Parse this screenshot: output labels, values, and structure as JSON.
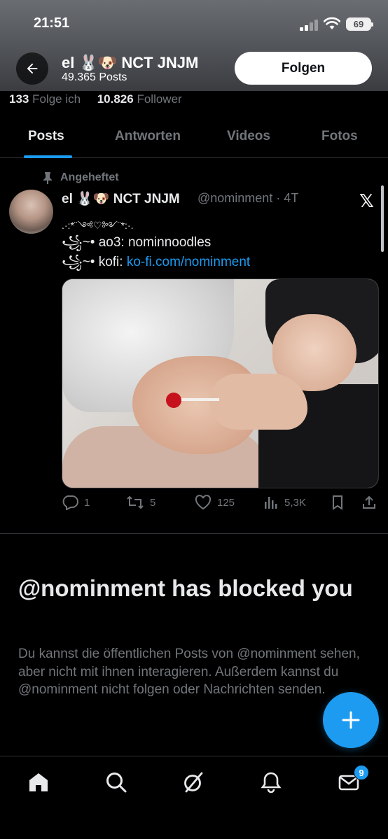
{
  "status_bar": {
    "time": "21:51",
    "battery": "69"
  },
  "header": {
    "display_name": "el 🐰🐶 NCT JNJM",
    "posts_count": "49.365 Posts",
    "follow_label": "Folgen"
  },
  "stats": {
    "following_count": "133",
    "following_label": "Folge ich",
    "followers_count": "10.826",
    "followers_label": "Follower"
  },
  "tabs": [
    {
      "label": "Posts",
      "active": true
    },
    {
      "label": "Antworten"
    },
    {
      "label": "Videos"
    },
    {
      "label": "Fotos"
    }
  ],
  "pinned_tweet": {
    "pinned_label": "Angeheftet",
    "author_name": "el 🐰🐶 NCT JNJM",
    "author_handle_time": "@nominment · 4T",
    "decor_line": ".·:*¨༺♡༻¨*:·.",
    "line1": "꧁~• ao3: nominnoodles",
    "line2_prefix": "꧁~• kofi: ",
    "line2_link": "ko-fi.com/nominment",
    "stats": {
      "replies": "1",
      "reposts": "5",
      "likes": "125",
      "views": "5,3K"
    }
  },
  "blocked": {
    "title": "@nominment has blocked you",
    "message": "Du kannst die öffentlichen Posts von @nominment sehen, aber nicht mit ihnen interagieren. Außerdem kannst du @nominment nicht folgen oder Nachrichten senden."
  },
  "bottom_nav": {
    "items": [
      "home-icon",
      "search-icon",
      "grok-icon",
      "notifications-icon",
      "messages-icon"
    ],
    "messages_badge": "9"
  },
  "colors": {
    "accent": "#1d9bf0",
    "background": "#000000",
    "secondary_text": "#71767b"
  }
}
